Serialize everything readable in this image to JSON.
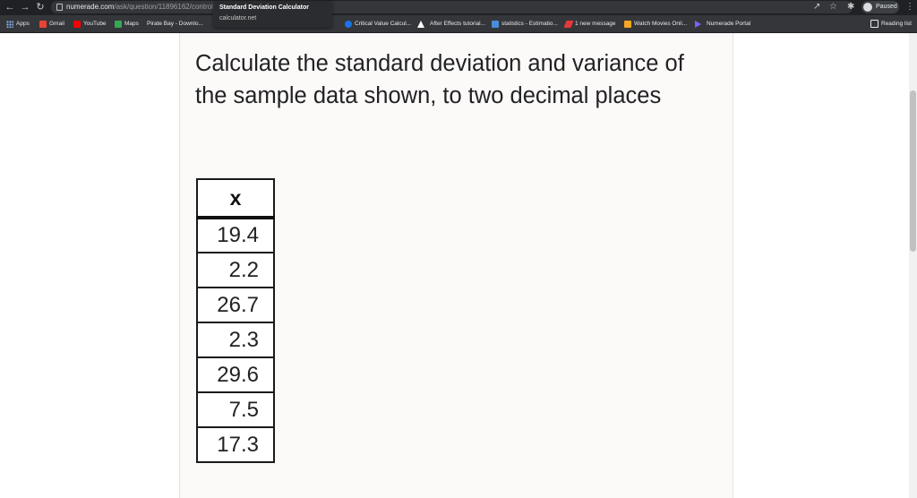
{
  "browser": {
    "url_domain": "numerade.com",
    "url_path": "/ask/question/11896162/control/",
    "tooltip_title": "Standard Deviation Calculator",
    "tooltip_domain": "calculator.net",
    "profile_label": "Paused",
    "reading_list": "Reading list"
  },
  "bookmarks": [
    {
      "label": "Apps",
      "icon": "apps-grid-icon"
    },
    {
      "label": "Gmail",
      "icon": "gmail-icon"
    },
    {
      "label": "YouTube",
      "icon": "youtube-icon"
    },
    {
      "label": "Maps",
      "icon": "maps-icon"
    },
    {
      "label": "Pirate Bay - Downlo...",
      "icon": "page-icon"
    },
    {
      "label": "Critical Value Calcul...",
      "icon": "critical-value-icon"
    },
    {
      "label": "After Effects tutorial...",
      "icon": "after-effects-icon"
    },
    {
      "label": "statistics - Estimatio...",
      "icon": "statistics-icon"
    },
    {
      "label": "1 new message",
      "icon": "message-icon"
    },
    {
      "label": "Watch Movies Onli...",
      "icon": "movies-icon"
    },
    {
      "label": "Numerade Portal",
      "icon": "numerade-icon"
    }
  ],
  "question": {
    "text": "Calculate the standard deviation and variance of the sample data shown, to two decimal places"
  },
  "table": {
    "header": "x",
    "values": [
      "19.4",
      "2.2",
      "26.7",
      "2.3",
      "29.6",
      "7.5",
      "17.3"
    ]
  }
}
